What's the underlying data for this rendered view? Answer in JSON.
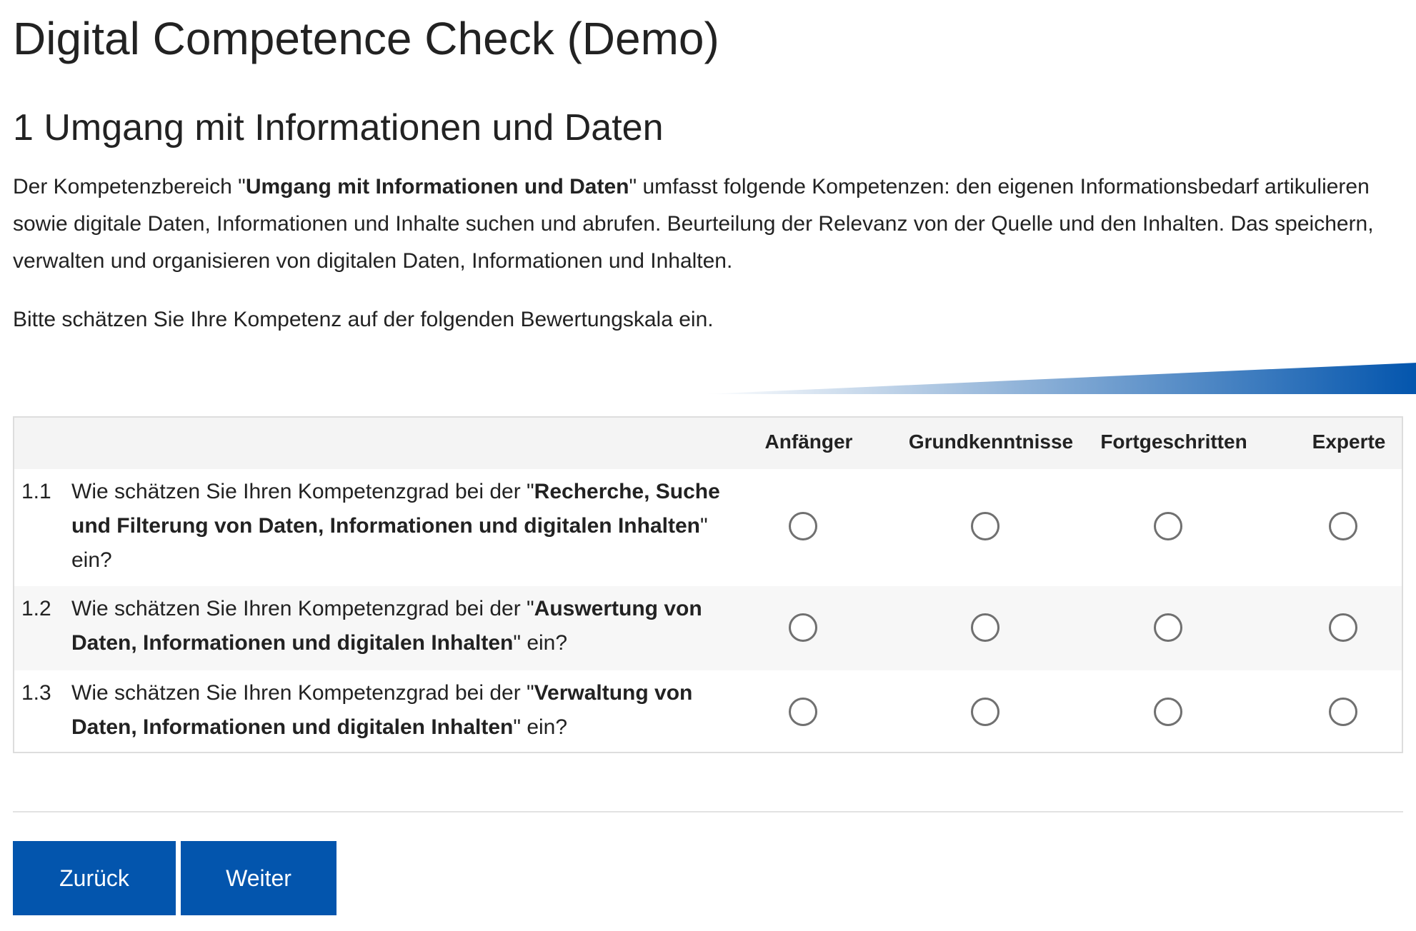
{
  "page": {
    "title": "Digital Competence Check (Demo)"
  },
  "section": {
    "title": "1 Umgang mit Informationen und Daten",
    "intro_before": "Der Kompetenzbereich \"",
    "intro_bold": "Umgang mit Informationen und Daten",
    "intro_after": "\" umfasst folgende Kompetenzen: den eigenen Informationsbedarf artikulieren sowie digitale Daten, Informationen und Inhalte suchen und abrufen. Beurteilung der Relevanz von der Quelle und den Inhalten. Das speichern, verwalten und organisieren von digitalen Daten, Informationen und Inhalten.",
    "instruction": "Bitte schätzen Sie Ihre Kompetenz auf der folgenden Bewertungskala ein."
  },
  "scale": {
    "columns": [
      "Anfänger",
      "Grundkenntnisse",
      "Fortgeschritten",
      "Experte"
    ],
    "gradient_start_color": "#ffffff",
    "gradient_end_color": "#0355ad"
  },
  "questions": [
    {
      "number": "1.1",
      "prefix": "Wie schätzen Sie Ihren Kompetenzgrad bei der \"",
      "bold": "Recherche, Suche und Filterung von Daten, Informationen und digitalen Inhalten",
      "suffix": "\" ein?",
      "selected": null
    },
    {
      "number": "1.2",
      "prefix": "Wie schätzen Sie Ihren Kompetenzgrad bei der \"",
      "bold": "Auswertung von Daten, Informationen und digitalen Inhalten",
      "suffix": "\" ein?",
      "selected": null
    },
    {
      "number": "1.3",
      "prefix": "Wie schätzen Sie Ihren Kompetenzgrad bei der \"",
      "bold": "Verwaltung von Daten, Informationen und digitalen Inhalten",
      "suffix": "\" ein?",
      "selected": null
    }
  ],
  "buttons": {
    "back_label": "Zurück",
    "next_label": "Weiter"
  },
  "colors": {
    "primary": "#0355ad",
    "table_header_bg": "#f4f4f4",
    "row_alt_bg": "#f7f7f7"
  }
}
